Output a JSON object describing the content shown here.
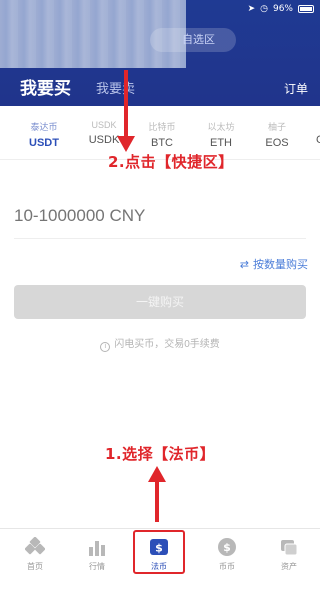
{
  "status_bar": {
    "battery_text": "96%"
  },
  "header": {
    "search_text": "自选区",
    "tab_buy": "我要买",
    "tab_sell": "我要卖",
    "orders": "订单"
  },
  "coins": [
    {
      "cn": "泰达币",
      "sym": "USDT",
      "active": true
    },
    {
      "cn": "USDK",
      "sym": "USDK",
      "active": false
    },
    {
      "cn": "比特币",
      "sym": "BTC",
      "active": false
    },
    {
      "cn": "以太坊",
      "sym": "ETH",
      "active": false
    },
    {
      "cn": "柚子",
      "sym": "EOS",
      "active": false
    }
  ],
  "coin_partial": "C",
  "form": {
    "amount_placeholder": "10-1000000 CNY",
    "switch_label": "按数量购买",
    "buy_button": "一键购买",
    "tip": "闪电买币，交易0手续费"
  },
  "annotations": {
    "step2": "2.点击【快捷区】",
    "step1": "1.选择【法币】"
  },
  "bottom_nav": [
    {
      "label": "首页",
      "icon": "home-icon"
    },
    {
      "label": "行情",
      "icon": "market-icon"
    },
    {
      "label": "法币",
      "icon": "fiat-icon"
    },
    {
      "label": "币币",
      "icon": "coin-icon"
    },
    {
      "label": "资产",
      "icon": "assets-icon"
    }
  ],
  "colors": {
    "header_bg": "#1f3a93",
    "accent": "#2c4fb8",
    "annotation": "#e0262b"
  }
}
